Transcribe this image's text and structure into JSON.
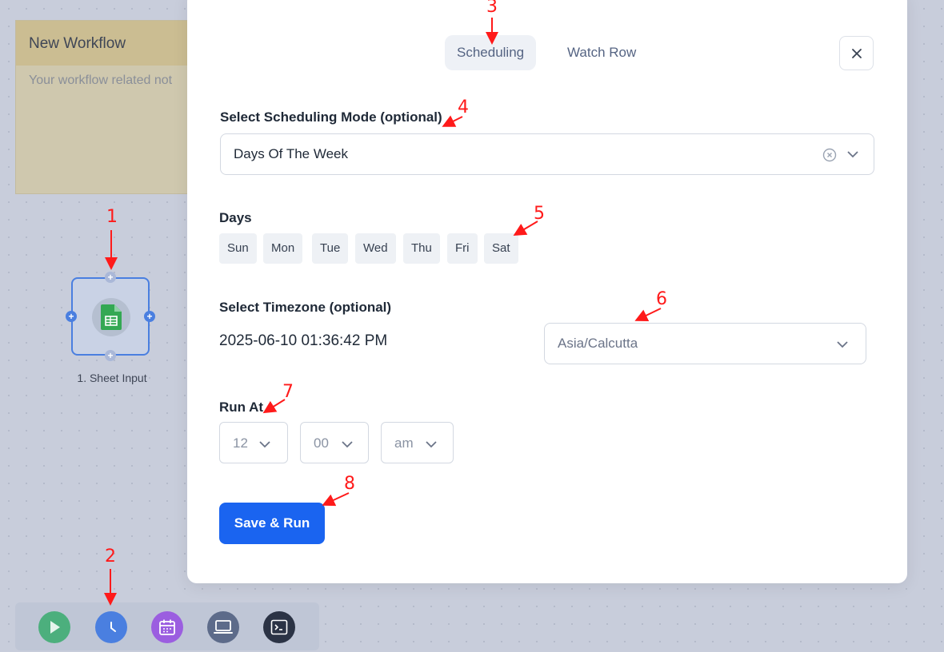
{
  "canvas": {
    "note": {
      "title": "New Workflow",
      "body": "Your workflow related not"
    },
    "node": {
      "label": "1. Sheet Input",
      "icon": "google-sheets-icon",
      "port_symbol": "+"
    },
    "toolbar": {
      "buttons": [
        {
          "name": "run",
          "icon": "play-icon",
          "color": "#4caf7d"
        },
        {
          "name": "schedule",
          "icon": "clock-icon",
          "color": "#4a7fe0"
        },
        {
          "name": "calendar",
          "icon": "calendar-icon",
          "color": "#9b5ee0"
        },
        {
          "name": "monitor",
          "icon": "laptop-icon",
          "color": "#5d6b8a"
        },
        {
          "name": "terminal",
          "icon": "terminal-icon",
          "color": "#2b3345"
        }
      ]
    }
  },
  "modal": {
    "tabs": [
      {
        "label": "Scheduling",
        "active": true
      },
      {
        "label": "Watch Row",
        "active": false
      }
    ],
    "close_icon": "close-icon",
    "scheduling_mode": {
      "label": "Select Scheduling Mode (optional)",
      "value": "Days Of The Week"
    },
    "days": {
      "label": "Days",
      "items": [
        "Sun",
        "Mon",
        "Tue",
        "Wed",
        "Thu",
        "Fri",
        "Sat"
      ]
    },
    "timezone": {
      "label": "Select Timezone (optional)",
      "current_time": "2025-06-10 01:36:42 PM",
      "value": "Asia/Calcutta"
    },
    "run_at": {
      "label": "Run At",
      "hour": "12",
      "minute": "00",
      "period": "am"
    },
    "save_label": "Save & Run"
  },
  "annotations": [
    "1",
    "2",
    "3",
    "4",
    "5",
    "6",
    "7",
    "8"
  ],
  "colors": {
    "accent": "#1a64f0",
    "annotation": "#ff1a1a"
  }
}
